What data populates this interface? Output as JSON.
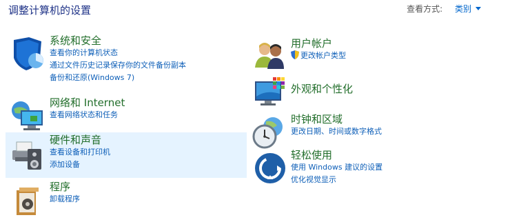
{
  "header": {
    "title": "调整计算机的设置",
    "view_by_label": "查看方式:",
    "view_by_value": "类别"
  },
  "categories": [
    {
      "title": "系统和安全",
      "links": [
        "查看你的计算机状态",
        "通过文件历史记录保存你的文件备份副本",
        "备份和还原(Windows 7)"
      ],
      "icon": "shield-pie-icon"
    },
    {
      "title": "网络和 Internet",
      "links": [
        "查看网络状态和任务"
      ],
      "icon": "network-globe-icon"
    },
    {
      "title": "硬件和声音",
      "links": [
        "查看设备和打印机",
        "添加设备"
      ],
      "icon": "printer-speaker-icon"
    },
    {
      "title": "程序",
      "links": [
        "卸载程序"
      ],
      "icon": "programs-box-icon"
    },
    {
      "title": "用户帐户",
      "links": [
        "更改帐户类型"
      ],
      "icon": "users-icon"
    },
    {
      "title": "外观和个性化",
      "links": [],
      "icon": "monitor-palette-icon"
    },
    {
      "title": "时钟和区域",
      "links": [
        "更改日期、时间或数字格式"
      ],
      "icon": "clock-globe-icon"
    },
    {
      "title": "轻松使用",
      "links": [
        "使用 Windows 建议的设置",
        "优化视觉显示"
      ],
      "icon": "ease-of-access-icon"
    }
  ]
}
